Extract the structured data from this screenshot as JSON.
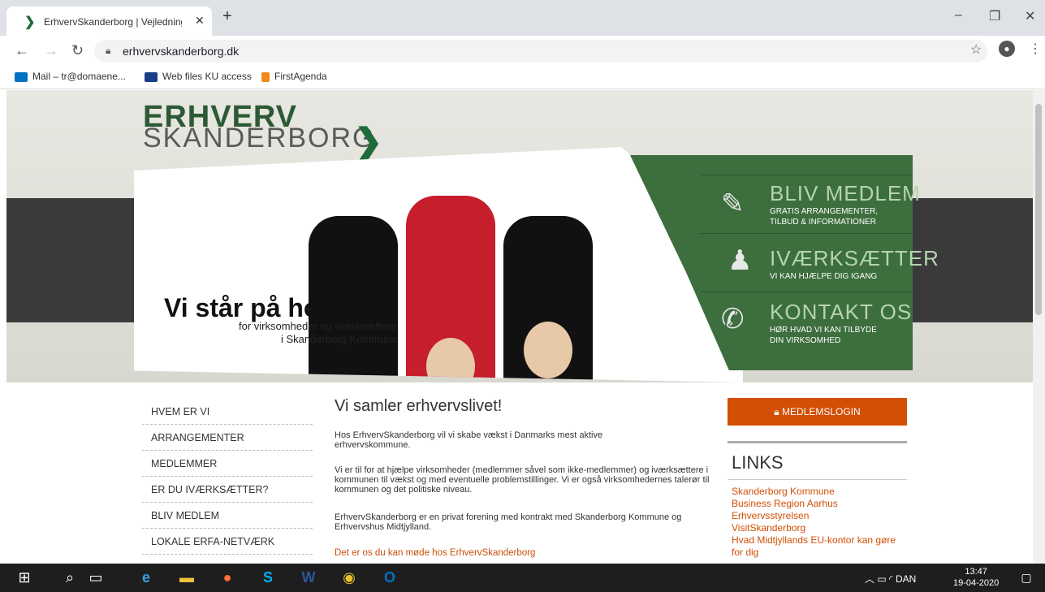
{
  "browser": {
    "tab_title": "ErhvervSkanderborg | Vejledning",
    "tab_icon": "❯",
    "url": "erhvervskanderborg.dk",
    "bookmarks": [
      {
        "label": "Mail – tr@domaene...",
        "color": "#0072c6"
      },
      {
        "label": "Web files KU access",
        "color": "#1a3f8a"
      },
      {
        "label": "FirstAgenda",
        "color": "#f08a1c"
      }
    ]
  },
  "site": {
    "logo_line1": "ERHVERV",
    "logo_line2": "SKANDERBORG",
    "logo_chevron": "❯",
    "headline": "Vi står på hovedet",
    "subline1": "for virksomheder og iværksættere",
    "subline2": "i Skanderborg Kommune",
    "panel": [
      {
        "title": "BLIV MEDLEM",
        "sub1": "GRATIS ARRANGEMENTER,",
        "sub2": "TILBUD & INFORMATIONER",
        "icon": "document-icon"
      },
      {
        "title": "IVÆRKSÆTTER",
        "sub1": "VI KAN HJÆLPE DIG IGANG",
        "sub2": "",
        "icon": "person-icon"
      },
      {
        "title": "KONTAKT OS",
        "sub1": "HØR HVAD VI KAN TILBYDE",
        "sub2": "DIN VIRKSOMHED",
        "icon": "phone-icon"
      }
    ]
  },
  "nav": {
    "items": [
      "HVEM ER VI",
      "ARRANGEMENTER",
      "MEDLEMMER",
      "ER DU IVÆRKSÆTTER?",
      "BLIV MEDLEM",
      "LOKALE ERFA-NETVÆRK"
    ]
  },
  "main": {
    "title": "Vi samler erhvervslivet!",
    "p1": "Hos ErhvervSkanderborg vil vi skabe vækst i Danmarks mest aktive erhvervskommune.",
    "p2": "Vi er til for at hjælpe virksomheder (medlemmer såvel som ikke-medlemmer) og iværksættere i kommunen til vækst og med eventuelle problemstillinger. Vi er også virksomhedernes talerør til kommunen og det politiske niveau.",
    "p3": "ErhvervSkanderborg er en privat forening med kontrakt med Skanderborg Kommune og Erhvervshus Midtjylland.",
    "more": "Det er os du kan møde hos ErhvervSkanderborg"
  },
  "sidebar": {
    "login_label": "MEDLEMSLOGIN",
    "links_title": "LINKS",
    "links": [
      "Skanderborg Kommune",
      "Business Region Aarhus",
      "Erhvervsstyrelsen",
      "VisitSkanderborg",
      "Hvad Midtjyllands EU-kontor kan gøre for dig"
    ]
  },
  "taskbar": {
    "language": "DAN",
    "time": "13:47",
    "date": "19-04-2020"
  }
}
